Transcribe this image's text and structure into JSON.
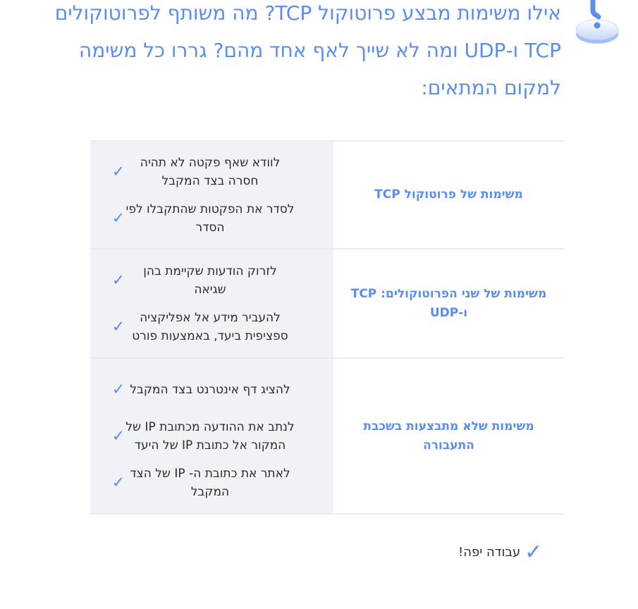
{
  "question": {
    "text": "אילו משימות מבצע פרוטוקול TCP? מה משותף לפרוטוקולים TCP ו-UDP ומה לא שייך לאף אחד מהם? גררו כל משימה למקום המתאים:"
  },
  "icon": "question-mark-icon",
  "colors": {
    "accent": "#5b8def",
    "row_bg": "#f1f2f8",
    "divider": "#e8ebf2",
    "text": "#2b2b2b"
  },
  "table": {
    "rows": [
      {
        "category": "משימות של פרוטוקול TCP",
        "items": [
          "לוודא שאף פקטה לא תהיה חסרה בצד המקבל",
          "לסדר את הפקטות שהתקבלו לפי הסדר"
        ]
      },
      {
        "category": "משימות של שני הפרוטוקולים: TCP ו-UDP",
        "items": [
          "לזרוק הודעות שקיימת בהן שגיאה",
          "להעביר מידע אל אפליקציה ספציפית ביעד, באמצעות פורט"
        ]
      },
      {
        "category": "משימות שלא מתבצעות בשכבת התעבורה",
        "items": [
          "להציג דף אינטרנט בצד המקבל",
          "לנתב את ההודעה מכתובת IP של המקור אל כתובת IP של היעד",
          "לאתר את כתובת ה- IP של הצד המקבל"
        ]
      }
    ],
    "check_glyph": "✓"
  },
  "footer": {
    "text": "עבודה יפה!",
    "check_glyph": "✓"
  }
}
